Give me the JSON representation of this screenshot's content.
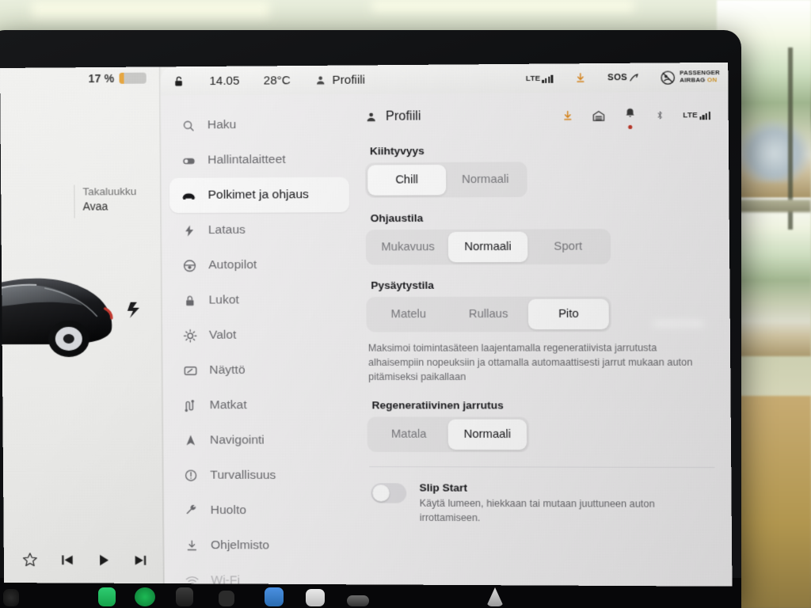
{
  "statusbar": {
    "lock_icon": "unlock-icon",
    "time": "14.05",
    "temperature": "28°C",
    "profile_icon": "person-icon",
    "profile": "Profiili",
    "lte_label": "LTE",
    "download_icon": "download-icon",
    "sos": "SOS",
    "airbag_line1": "PASSENGER",
    "airbag_line2": "AIRBAG",
    "airbag_state": "ON"
  },
  "car_panel": {
    "battery_percent": "17 %",
    "battery_level": 17,
    "trunk_label": "Takaluukku",
    "trunk_action": "Avaa",
    "media": {
      "favorite_icon": "star-icon",
      "previous_icon": "previous-track-icon",
      "play_icon": "play-icon",
      "next_icon": "next-track-icon"
    }
  },
  "sidebar": {
    "items": [
      {
        "label": "Haku",
        "icon": "search-icon",
        "active": false,
        "dim": false
      },
      {
        "label": "Hallintalaitteet",
        "icon": "toggle-icon",
        "active": false,
        "dim": false
      },
      {
        "label": "Polkimet ja ohjaus",
        "icon": "car-icon",
        "active": true,
        "dim": false
      },
      {
        "label": "Lataus",
        "icon": "bolt-icon",
        "active": false,
        "dim": false
      },
      {
        "label": "Autopilot",
        "icon": "steering-wheel-icon",
        "active": false,
        "dim": false
      },
      {
        "label": "Lukot",
        "icon": "lock-icon",
        "active": false,
        "dim": false
      },
      {
        "label": "Valot",
        "icon": "light-icon",
        "active": false,
        "dim": false
      },
      {
        "label": "Näyttö",
        "icon": "display-icon",
        "active": false,
        "dim": false
      },
      {
        "label": "Matkat",
        "icon": "trips-icon",
        "active": false,
        "dim": false
      },
      {
        "label": "Navigointi",
        "icon": "navigation-icon",
        "active": false,
        "dim": false
      },
      {
        "label": "Turvallisuus",
        "icon": "safety-icon",
        "active": false,
        "dim": false
      },
      {
        "label": "Huolto",
        "icon": "wrench-icon",
        "active": false,
        "dim": false
      },
      {
        "label": "Ohjelmisto",
        "icon": "software-download-icon",
        "active": false,
        "dim": false
      },
      {
        "label": "Wi-Fi",
        "icon": "wifi-icon",
        "active": false,
        "dim": true
      }
    ]
  },
  "content": {
    "title": "Profiili",
    "title_icon": "person-icon",
    "head_icons": [
      "download-icon",
      "garage-icon",
      "bell-icon",
      "bluetooth-icon",
      "lte-signal-icon"
    ],
    "sections": [
      {
        "label": "Kiihtyvyys",
        "options": [
          "Chill",
          "Normaali"
        ],
        "selected": "Chill",
        "description": ""
      },
      {
        "label": "Ohjaustila",
        "options": [
          "Mukavuus",
          "Normaali",
          "Sport"
        ],
        "selected": "Normaali",
        "description": ""
      },
      {
        "label": "Pysäytystila",
        "options": [
          "Matelu",
          "Rullaus",
          "Pito"
        ],
        "selected": "Pito",
        "description": "Maksimoi toimintasäteen laajentamalla regeneratiivista jarrutusta alhaisempiin nopeuksiin ja ottamalla automaattisesti jarrut mukaan auton pitämiseksi paikallaan"
      },
      {
        "label": "Regeneratiivinen jarrutus",
        "options": [
          "Matala",
          "Normaali"
        ],
        "selected": "Normaali",
        "description": ""
      }
    ],
    "toggle": {
      "title": "Slip Start",
      "description": "Käytä lumeen, hiekkaan tai mutaan juuttuneen auton irrottamiseen.",
      "state": "off"
    }
  },
  "colors": {
    "accent_orange": "#e8a53a",
    "notification_red": "#c0392b",
    "panel_bg": "#f0eff0",
    "selected_pill": "#fdfdfd"
  }
}
